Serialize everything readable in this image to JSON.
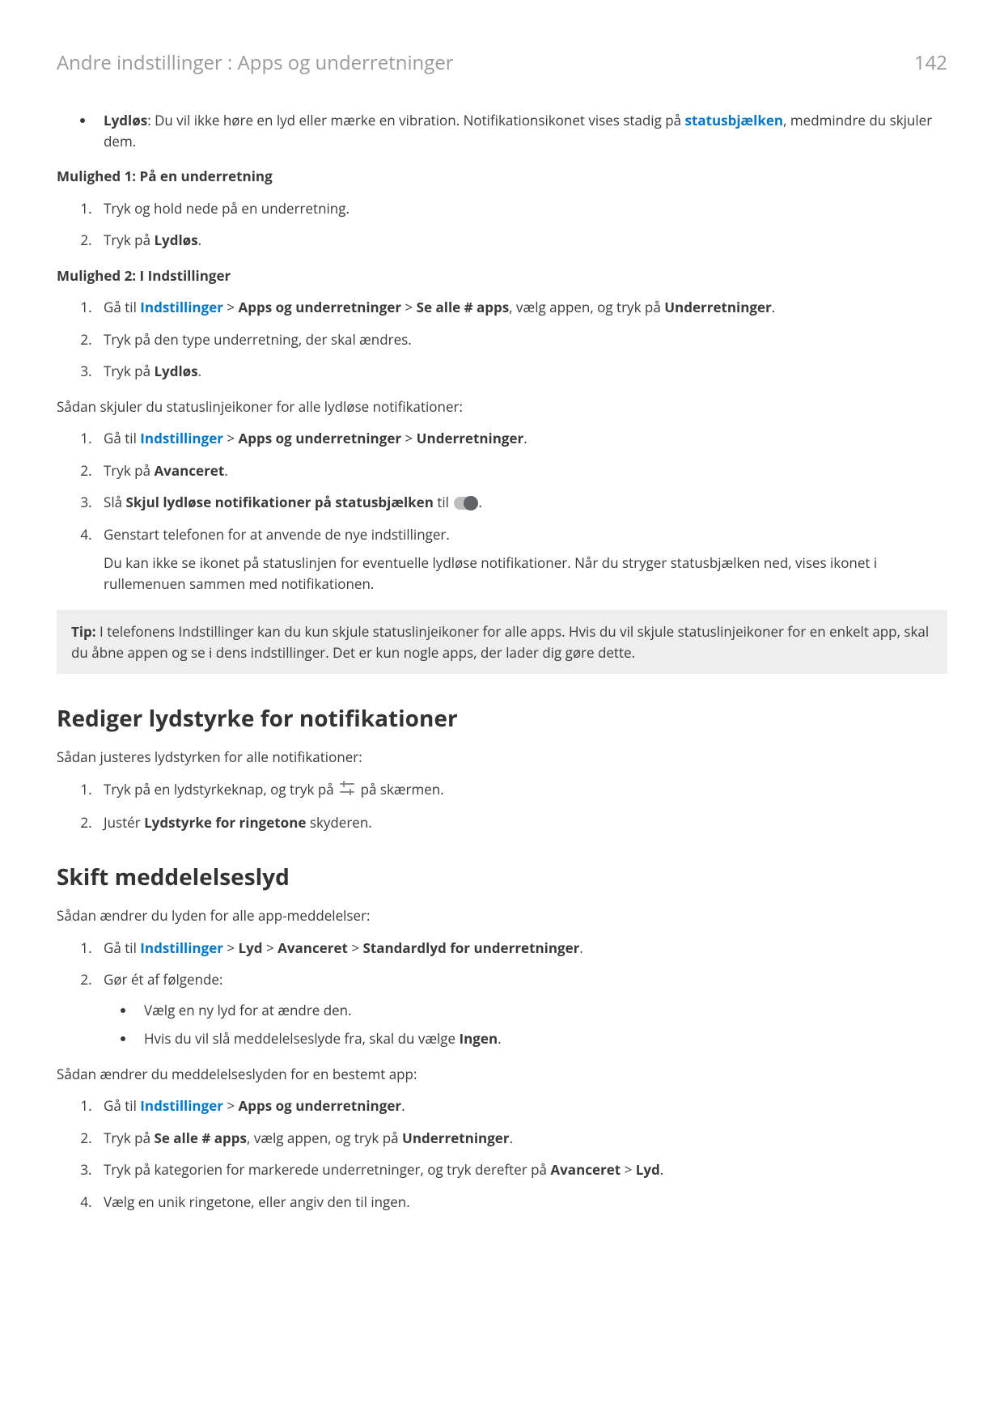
{
  "header": {
    "title": "Andre indstillinger : Apps og underretninger",
    "page_number": "142"
  },
  "intro_bullet": {
    "label": "Lydløs",
    "text_before": ": Du vil ikke høre en lyd eller mærke en vibration. Notifikationsikonet vises stadig på ",
    "link": "statusbjælken",
    "text_after": ", medmindre du skjuler dem."
  },
  "option1": {
    "heading": "Mulighed 1: På en underretning",
    "steps": [
      "Tryk og hold nede på en underretning.",
      {
        "pre": "Tryk på ",
        "bold": "Lydløs",
        "post": "."
      }
    ]
  },
  "option2": {
    "heading": "Mulighed 2: I Indstillinger",
    "step1": {
      "pre": "Gå til ",
      "link": "Indstillinger",
      "mid1": " > ",
      "b1": "Apps og underretninger",
      "mid2": " > ",
      "b2": "Se alle # apps",
      "mid3": ", vælg appen, og tryk på ",
      "b3": "Underretninger",
      "post": "."
    },
    "step2": "Tryk på den type underretning, der skal ændres.",
    "step3": {
      "pre": "Tryk på ",
      "bold": "Lydløs",
      "post": "."
    }
  },
  "hide_intro": "Sådan skjuler du statuslinjeikoner for alle lydløse notifikationer:",
  "hide_steps": {
    "s1": {
      "pre": "Gå til ",
      "link": "Indstillinger",
      "mid1": " > ",
      "b1": "Apps og underretninger",
      "mid2": " > ",
      "b2": "Underretninger",
      "post": "."
    },
    "s2": {
      "pre": "Tryk på ",
      "bold": "Avanceret",
      "post": "."
    },
    "s3": {
      "pre": "Slå ",
      "bold": "Skjul lydløse notifikationer på statusbjælken",
      "mid": " til ",
      "post": "."
    },
    "s4": {
      "line1": "Genstart telefonen for at anvende de nye indstillinger.",
      "line2": "Du kan ikke se ikonet på statuslinjen for eventuelle lydløse notifikationer. Når du stryger statusbjælken ned, vises ikonet i rullemenuen sammen med notifikationen."
    }
  },
  "tip": {
    "label": "Tip:",
    "text": " I telefonens Indstillinger kan du kun skjule statuslinjeikoner for alle apps. Hvis du vil skjule statuslinjeikoner for en enkelt app, skal du åbne appen og se i dens indstillinger. Det er kun nogle apps, der lader dig gøre dette."
  },
  "vol": {
    "title": "Rediger lydstyrke for notifikationer",
    "intro": "Sådan justeres lydstyrken for alle notifikationer:",
    "s1": {
      "pre": "Tryk på en lydstyrkeknap, og tryk på ",
      "post": " på skærmen."
    },
    "s2": {
      "pre": "Justér ",
      "bold": "Lydstyrke for ringetone",
      "post": " skyderen."
    }
  },
  "sound": {
    "title": "Skift meddelelseslyd",
    "intro1": "Sådan ændrer du lyden for alle app-meddelelser:",
    "s1": {
      "pre": "Gå til ",
      "link": "Indstillinger",
      "mid1": " > ",
      "b1": "Lyd",
      "mid2": " > ",
      "b2": "Avanceret",
      "mid3": " > ",
      "b3": "Standardlyd for underretninger",
      "post": "."
    },
    "s2": {
      "text": "Gør ét af følgende:",
      "sub1": "Vælg en ny lyd for at ændre den.",
      "sub2": {
        "pre": "Hvis du vil slå meddelelseslyde fra, skal du vælge ",
        "bold": "Ingen",
        "post": "."
      }
    },
    "intro2": "Sådan ændrer du meddelelseslyden for en bestemt app:",
    "a1": {
      "pre": "Gå til ",
      "link": "Indstillinger",
      "mid": " > ",
      "b1": "Apps og underretninger",
      "post": "."
    },
    "a2": {
      "pre": "Tryk på ",
      "b1": "Se alle # apps",
      "mid": ", vælg appen, og tryk på ",
      "b2": "Underretninger",
      "post": "."
    },
    "a3": {
      "pre": "Tryk på kategorien for markerede underretninger, og tryk derefter på ",
      "b1": "Avanceret",
      "mid": " > ",
      "b2": "Lyd",
      "post": "."
    },
    "a4": "Vælg en unik ringetone, eller angiv den til ingen."
  }
}
